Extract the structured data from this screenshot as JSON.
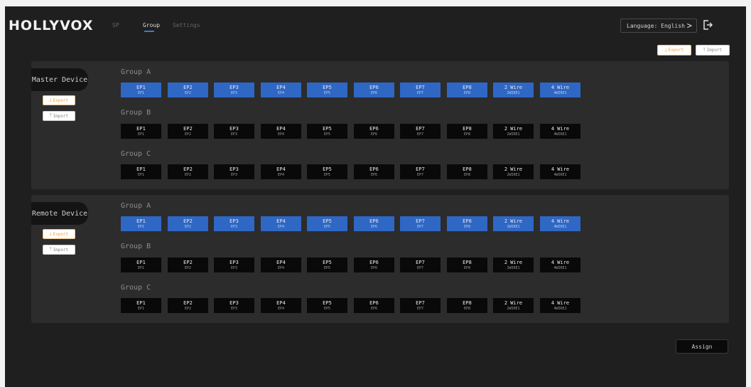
{
  "header": {
    "logo": "HOLLYVOX",
    "tabs": [
      {
        "label": "SP",
        "active": false
      },
      {
        "label": "Group",
        "active": true
      },
      {
        "label": "Settings",
        "active": false
      }
    ],
    "language": "Language: English",
    "chevron_icon": ">",
    "logout_icon": "logout-icon"
  },
  "toolbar": {
    "export_label": "Export",
    "import_label": "Import",
    "export_color": "#f0a040"
  },
  "panels": [
    {
      "device": "Master Device",
      "export_label": "Export",
      "import_label": "Import",
      "groups": [
        {
          "title": "Group A",
          "color": "blue"
        },
        {
          "title": "Group B",
          "color": "black"
        },
        {
          "title": "Group C",
          "color": "black"
        }
      ]
    },
    {
      "device": "Remote Device",
      "export_label": "Export",
      "import_label": "Import",
      "groups": [
        {
          "title": "Group A",
          "color": "blue"
        },
        {
          "title": "Group B",
          "color": "black"
        },
        {
          "title": "Group C",
          "color": "black"
        }
      ]
    }
  ],
  "cells": [
    {
      "name": "EP1",
      "sub": "EP1"
    },
    {
      "name": "EP2",
      "sub": "EP2"
    },
    {
      "name": "EP3",
      "sub": "EP3"
    },
    {
      "name": "EP4",
      "sub": "EP4"
    },
    {
      "name": "EP5",
      "sub": "EP5"
    },
    {
      "name": "EP6",
      "sub": "EP6"
    },
    {
      "name": "EP7",
      "sub": "EP7"
    },
    {
      "name": "EP8",
      "sub": "EP8"
    },
    {
      "name": "2 Wire",
      "sub": "2WIRE1"
    },
    {
      "name": "4 Wire",
      "sub": "4WIRE1"
    }
  ],
  "assign_label": "Assign",
  "colors": {
    "selected_cell": "#2f67c4",
    "unselected_cell": "#090909",
    "background": "#1f1f1f",
    "panel": "#2c2c2c"
  }
}
